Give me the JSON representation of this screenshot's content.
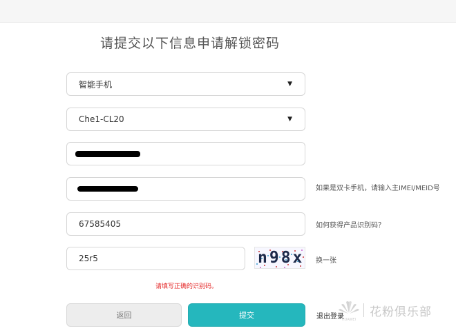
{
  "page": {
    "title": "请提交以下信息申请解锁密码"
  },
  "form": {
    "device_type": {
      "value": "智能手机",
      "caret": "▼"
    },
    "model": {
      "value": "Che1-CL20",
      "caret": "▼"
    },
    "imei1": {
      "value": ""
    },
    "imei2": {
      "value": "",
      "hint": "如果是双卡手机，请输入主IMEI/MEID号"
    },
    "product_id": {
      "value": "67585405",
      "hint": "如何获得产品识别码？"
    },
    "captcha_input": {
      "value": "25r5"
    },
    "captcha_image": {
      "text": "n98x",
      "refresh_label": "换一张"
    },
    "error_message": "请填写正确的识别码。"
  },
  "buttons": {
    "back": "返回",
    "submit": "提交",
    "logout": "退出登录"
  },
  "watermark": {
    "text": "花粉俱乐部",
    "brand": "HUAWEI"
  },
  "colors": {
    "accent": "#25b7bd",
    "error": "#e52a2a"
  }
}
